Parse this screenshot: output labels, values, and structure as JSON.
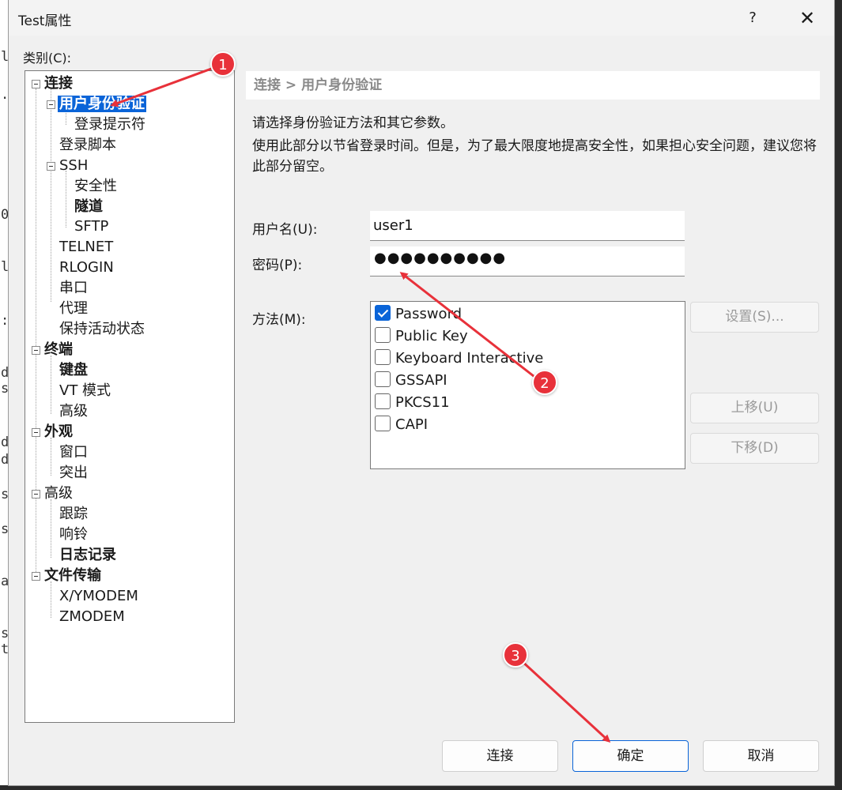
{
  "window": {
    "title": "Test属性",
    "help": "?",
    "close": "✕"
  },
  "background_terminal": [
    "l",
    ".",
    "0",
    "l",
    ":",
    "d",
    "s",
    "d",
    "d",
    "s",
    "s",
    "a",
    "s",
    "t"
  ],
  "category_label": "类别(C):",
  "tree": [
    {
      "label": "连接",
      "bold": true
    },
    {
      "label": "用户身份验证",
      "selected": true
    },
    {
      "label": "登录提示符"
    },
    {
      "label": "登录脚本"
    },
    {
      "label": "SSH"
    },
    {
      "label": "安全性"
    },
    {
      "label": "隧道",
      "bold": true
    },
    {
      "label": "SFTP"
    },
    {
      "label": "TELNET"
    },
    {
      "label": "RLOGIN"
    },
    {
      "label": "串口"
    },
    {
      "label": "代理"
    },
    {
      "label": "保持活动状态"
    },
    {
      "label": "终端",
      "bold": true
    },
    {
      "label": "键盘",
      "bold": true
    },
    {
      "label": "VT 模式"
    },
    {
      "label": "高级"
    },
    {
      "label": "外观",
      "bold": true
    },
    {
      "label": "窗口"
    },
    {
      "label": "突出"
    },
    {
      "label": "高级"
    },
    {
      "label": "跟踪"
    },
    {
      "label": "响铃"
    },
    {
      "label": "日志记录",
      "bold": true
    },
    {
      "label": "文件传输",
      "bold": true
    },
    {
      "label": "X/YMODEM"
    },
    {
      "label": "ZMODEM"
    }
  ],
  "breadcrumb": "连接 > 用户身份验证",
  "description1": "请选择身份验证方法和其它参数。",
  "description2": "使用此部分以节省登录时间。但是，为了最大限度地提高安全性，如果担心安全问题，建议您将此部分留空。",
  "username": {
    "label": "用户名(U):",
    "value": "user1"
  },
  "password": {
    "label": "密码(P):",
    "value": "●●●●●●●●●●"
  },
  "method": {
    "label": "方法(M):",
    "items": [
      {
        "label": "Password",
        "checked": true
      },
      {
        "label": "Public Key",
        "checked": false
      },
      {
        "label": "Keyboard Interactive",
        "checked": false
      },
      {
        "label": "GSSAPI",
        "checked": false
      },
      {
        "label": "PKCS11",
        "checked": false
      },
      {
        "label": "CAPI",
        "checked": false
      }
    ]
  },
  "side_buttons": {
    "settings": "设置(S)...",
    "move_up": "上移(U)",
    "move_down": "下移(D)"
  },
  "bottom_buttons": {
    "connect": "连接",
    "ok": "确定",
    "cancel": "取消"
  },
  "annotations": [
    "1",
    "2",
    "3"
  ],
  "colors": {
    "accent": "#0a64d8",
    "annotation": "#e8313a"
  }
}
